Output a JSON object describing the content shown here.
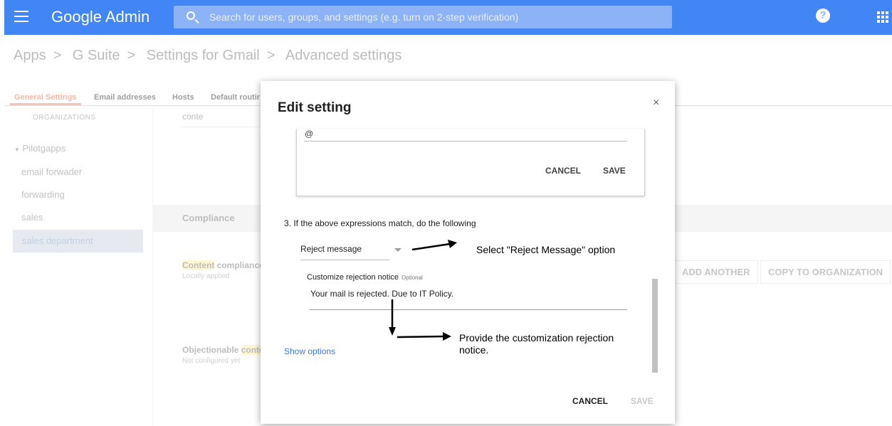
{
  "header": {
    "brand": "Google Admin",
    "search_placeholder": "Search for users, groups, and settings (e.g. turn on 2-step verification)",
    "help_label": "?"
  },
  "breadcrumb": [
    "Apps",
    "G Suite",
    "Settings for Gmail",
    "Advanced settings"
  ],
  "tabs": [
    {
      "label": "General Settings",
      "active": true
    },
    {
      "label": "Email addresses"
    },
    {
      "label": "Hosts"
    },
    {
      "label": "Default routir"
    }
  ],
  "sidebar": {
    "header": "ORGANIZATIONS",
    "root": "Pilotgapps",
    "items": [
      "email forwader",
      "forwarding",
      "sales",
      "sales department"
    ],
    "selected": "sales department"
  },
  "background": {
    "search_value": "conte",
    "section_title": "Compliance",
    "content_compliance": {
      "highlight": "Content",
      "rest": " compliance",
      "sub": "Locally applied"
    },
    "objectionable": {
      "prefix": "Objectionable ",
      "highlight": "conte",
      "sub": "Not configured yet"
    },
    "add_another": "ADD ANOTHER",
    "copy_to_org": "COPY TO ORGANIZATION"
  },
  "dialog": {
    "title": "Edit setting",
    "close": "×",
    "inner_field_value": "@",
    "inner_cancel": "CANCEL",
    "inner_save": "SAVE",
    "step_label": "3. If the above expressions match, do the following",
    "action_select": "Reject message",
    "customize_label": "Customize rejection notice",
    "customize_optional": "Optional",
    "customize_value": "Your mail is rejected. Due to IT Policy.",
    "show_options": "Show options",
    "cancel": "CANCEL",
    "save": "SAVE"
  },
  "annotations": {
    "select_hint": "Select \"Reject Message\" option",
    "notice_hint": "Provide the customization rejection notice."
  }
}
